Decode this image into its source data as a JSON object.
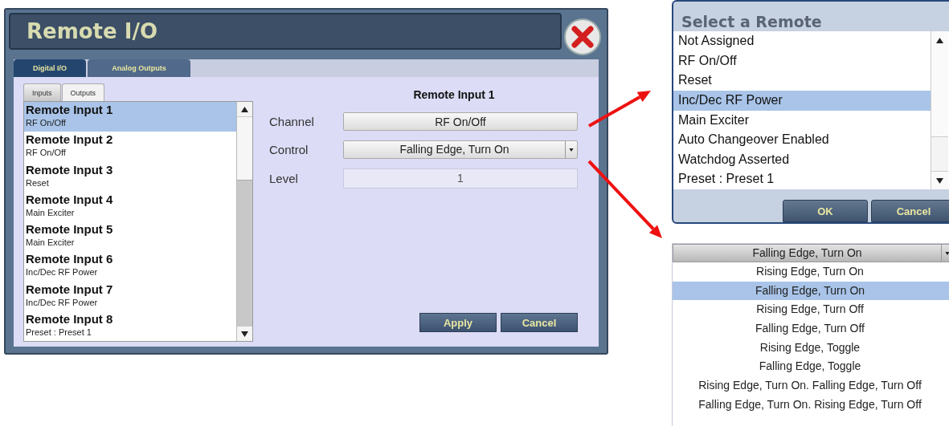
{
  "main_dialog": {
    "title": "Remote I/O",
    "tabs": [
      {
        "label": "Digital I/O",
        "selected": true
      },
      {
        "label": "Analog Outputs",
        "selected": false
      }
    ],
    "subtabs": [
      {
        "label": "Inputs",
        "selected": true
      },
      {
        "label": "Outputs",
        "selected": false
      }
    ],
    "inputs": [
      {
        "name": "Remote Input 1",
        "assignment": "RF On/Off",
        "selected": true
      },
      {
        "name": "Remote Input 2",
        "assignment": "RF On/Off",
        "selected": false
      },
      {
        "name": "Remote Input 3",
        "assignment": "Reset",
        "selected": false
      },
      {
        "name": "Remote Input 4",
        "assignment": "Main Exciter",
        "selected": false
      },
      {
        "name": "Remote Input 5",
        "assignment": "Main Exciter",
        "selected": false
      },
      {
        "name": "Remote Input 6",
        "assignment": "Inc/Dec RF Power",
        "selected": false
      },
      {
        "name": "Remote Input 7",
        "assignment": "Inc/Dec RF Power",
        "selected": false
      },
      {
        "name": "Remote Input 8",
        "assignment": "Preset : Preset 1",
        "selected": false
      }
    ],
    "detail": {
      "heading": "Remote Input 1",
      "fields": [
        {
          "label": "Channel",
          "value": "RF On/Off",
          "kind": "button"
        },
        {
          "label": "Control",
          "value": "Falling Edge, Turn On",
          "kind": "dropdown"
        },
        {
          "label": "Level",
          "value": "1",
          "kind": "readonly"
        }
      ]
    },
    "buttons": [
      "Apply",
      "Cancel"
    ]
  },
  "remote_picker": {
    "title": "Select a Remote",
    "options": [
      {
        "label": "Not Assigned",
        "selected": false
      },
      {
        "label": "RF On/Off",
        "selected": false
      },
      {
        "label": "Reset",
        "selected": false
      },
      {
        "label": "Inc/Dec RF Power",
        "selected": true
      },
      {
        "label": "Main Exciter",
        "selected": false
      },
      {
        "label": "Auto Changeover Enabled",
        "selected": false
      },
      {
        "label": "Watchdog Asserted",
        "selected": false
      },
      {
        "label": "Preset : Preset 1",
        "selected": false
      }
    ],
    "buttons": [
      "OK",
      "Cancel"
    ]
  },
  "control_dropdown": {
    "value": "Falling Edge, Turn On",
    "options": [
      {
        "label": "Rising Edge, Turn On",
        "selected": false
      },
      {
        "label": "Falling Edge, Turn On",
        "selected": true
      },
      {
        "label": "Rising Edge, Turn Off",
        "selected": false
      },
      {
        "label": "Falling Edge, Turn Off",
        "selected": false
      },
      {
        "label": "Rising Edge, Toggle",
        "selected": false
      },
      {
        "label": "Falling Edge, Toggle",
        "selected": false
      },
      {
        "label": "Rising Edge, Turn On. Falling Edge, Turn Off",
        "selected": false
      },
      {
        "label": "Falling Edge, Turn On. Rising Edge, Turn Off",
        "selected": false
      }
    ]
  }
}
